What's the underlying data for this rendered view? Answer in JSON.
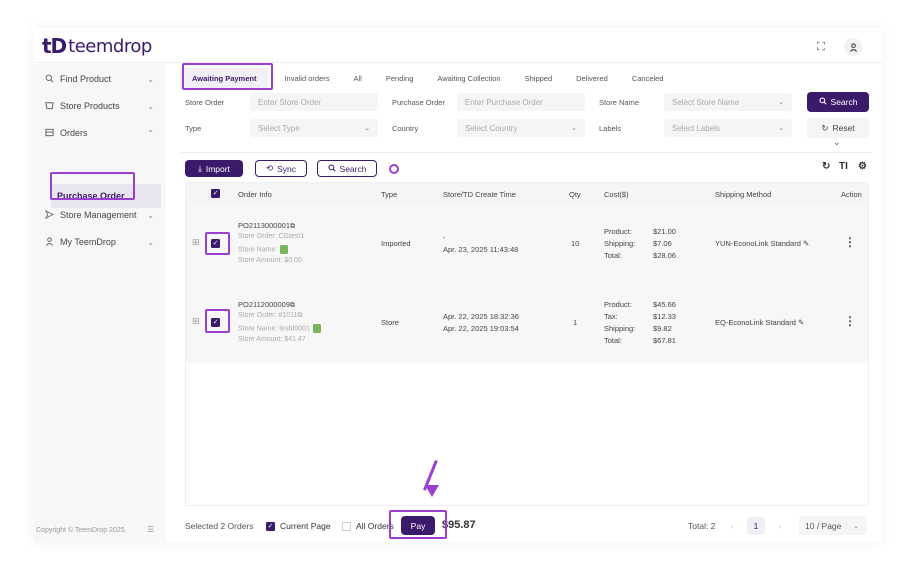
{
  "header": {
    "logo_mark": "tD",
    "logo_text": "teemdrop",
    "fullscreen_icon": "fullscreen-icon",
    "user_icon": "user-icon"
  },
  "sidebar": {
    "items": [
      {
        "label": "Find Product",
        "icon": "search-icon"
      },
      {
        "label": "Store Products",
        "icon": "store-icon"
      },
      {
        "label": "Orders",
        "icon": "orders-icon"
      },
      {
        "label": "Store Management",
        "icon": "send-icon"
      },
      {
        "label": "My TeemDrop",
        "icon": "user-icon"
      }
    ],
    "sub_item": "Purchase Order",
    "copyright": "Copyright © TeemDrop 2025."
  },
  "tabs": [
    "Awaiting Payment",
    "Invalid orders",
    "All",
    "Pending",
    "Awaiting Collection",
    "Shipped",
    "Delivered",
    "Canceled"
  ],
  "filters": {
    "store_order_label": "Store Order",
    "store_order_placeholder": "Enter Store Order",
    "purchase_order_label": "Purchase Order",
    "purchase_order_placeholder": "Enter Purchase Order",
    "store_name_label": "Store Name",
    "store_name_placeholder": "Select Store Name",
    "type_label": "Type",
    "type_placeholder": "Select Type",
    "country_label": "Country",
    "country_placeholder": "Select Country",
    "labels_label": "Labels",
    "labels_placeholder": "Select Labels",
    "search_btn": "Search",
    "reset_btn": "Reset"
  },
  "toolbar": {
    "import_btn": "Import",
    "sync_btn": "Sync",
    "search_btn": "Search"
  },
  "table": {
    "headers": [
      "Order Info",
      "Type",
      "Store/TD Create Time",
      "Qty",
      "Cost($)",
      "Shipping Method",
      "Action"
    ],
    "rows": [
      {
        "order_no": "PO2113000001",
        "store_order": "Store Order: CGtest1",
        "store_name": "Store Name:",
        "store_amount": "Store Amount: $0.00",
        "type": "Imported",
        "time1": "-",
        "time2": "Apr. 23, 2025 11:43:48",
        "qty": "10",
        "cost_labels": [
          "Product:",
          "Shipping:",
          "Total:"
        ],
        "cost_values": [
          "$21.00",
          "$7.06",
          "$28.06"
        ],
        "shipping": "YUN-EconoLink Standard"
      },
      {
        "order_no": "PO2112000009",
        "store_order": "Store Order: #1011",
        "store_name": "Store Name: testd0001",
        "store_amount": "Store Amount: $41.47",
        "type": "Store",
        "time1": "Apr. 22, 2025 18:32:36",
        "time2": "Apr. 22, 2025 19:03:54",
        "qty": "1",
        "cost_labels": [
          "Product:",
          "Tax:",
          "Shipping:",
          "Total:"
        ],
        "cost_values": [
          "$45.66",
          "$12.33",
          "$9.82",
          "$67.81"
        ],
        "shipping": "EQ-EconoLink Standard"
      }
    ]
  },
  "footer": {
    "selected": "Selected 2 Orders",
    "current_page": "Current Page",
    "all_orders": "All Orders",
    "pay_btn": "Pay",
    "amount": "$95.87",
    "total": "Total: 2",
    "page": "1",
    "per_page": "10 / Page"
  },
  "colors": {
    "brand": "#3a1a6b",
    "highlight": "#9b3fd0"
  }
}
